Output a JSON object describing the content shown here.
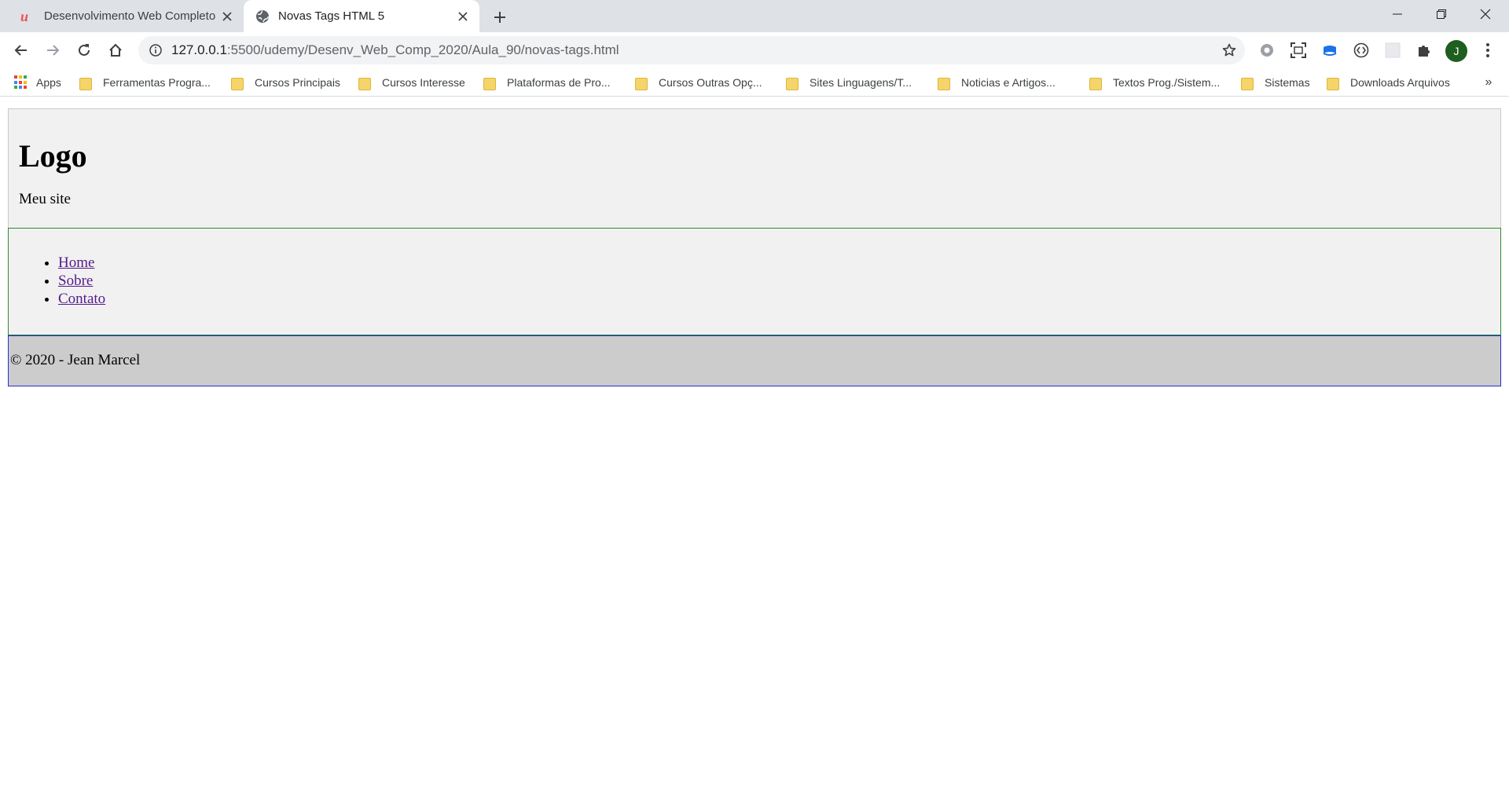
{
  "browser": {
    "tabs": [
      {
        "title": "Desenvolvimento Web Completo",
        "favicon": "udemy-icon",
        "active": false
      },
      {
        "title": "Novas Tags HTML 5",
        "favicon": "globe-icon",
        "active": true
      }
    ],
    "address": {
      "host": "127.0.0.1",
      "path": ":5500/udemy/Desenv_Web_Comp_2020/Aula_90/novas-tags.html"
    },
    "profile_initial": "J",
    "bookmarks": [
      "Apps",
      "Ferramentas Progra...",
      "Cursos Principais",
      "Cursos Interesse",
      "Plataformas de Pro...",
      "Cursos Outras Opç...",
      "Sites Linguagens/T...",
      "Noticias e Artigos...",
      "Textos Prog./Sistem...",
      "Sistemas",
      "Downloads Arquivos"
    ],
    "bookmarks_more": "»",
    "colors": {
      "tabstrip": "#dee1e6",
      "avatar": "#1e5e1e",
      "folder": "#f5d56a"
    }
  },
  "page": {
    "header": {
      "logo": "Logo",
      "subtitle": "Meu site"
    },
    "nav": {
      "items": [
        "Home",
        "Sobre",
        "Contato"
      ]
    },
    "footer": {
      "text": "© 2020 - Jean Marcel"
    }
  }
}
